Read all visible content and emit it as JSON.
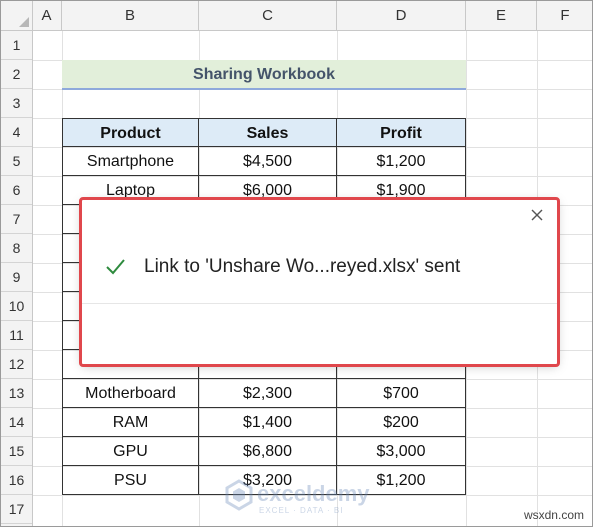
{
  "columns": [
    "A",
    "B",
    "C",
    "D",
    "E",
    "F"
  ],
  "rows": [
    "1",
    "2",
    "3",
    "4",
    "5",
    "6",
    "7",
    "8",
    "9",
    "10",
    "11",
    "12",
    "13",
    "14",
    "15",
    "16",
    "17"
  ],
  "sheet": {
    "title": "Sharing Workbook",
    "headers": [
      "Product",
      "Sales",
      "Profit"
    ],
    "visible_rows": [
      [
        "Smartphone",
        "$4,500",
        "$1,200"
      ],
      [
        "Laptop",
        "$6,000",
        "$1,900"
      ]
    ],
    "lower_rows": [
      [
        "Motherboard",
        "$2,300",
        "$700"
      ],
      [
        "RAM",
        "$1,400",
        "$200"
      ],
      [
        "GPU",
        "$6,800",
        "$3,000"
      ],
      [
        "PSU",
        "$3,200",
        "$1,200"
      ]
    ]
  },
  "dialog": {
    "message": "Link to 'Unshare Wo...reyed.xlsx' sent",
    "close_icon": "close-icon",
    "status_icon": "checkmark-icon",
    "highlight_color": "#e0474c",
    "success_color": "#2e8b3e"
  },
  "watermark": {
    "name": "exceldemy",
    "tagline": "EXCEL · DATA · BI"
  },
  "site_tag": "wsxdn.com"
}
